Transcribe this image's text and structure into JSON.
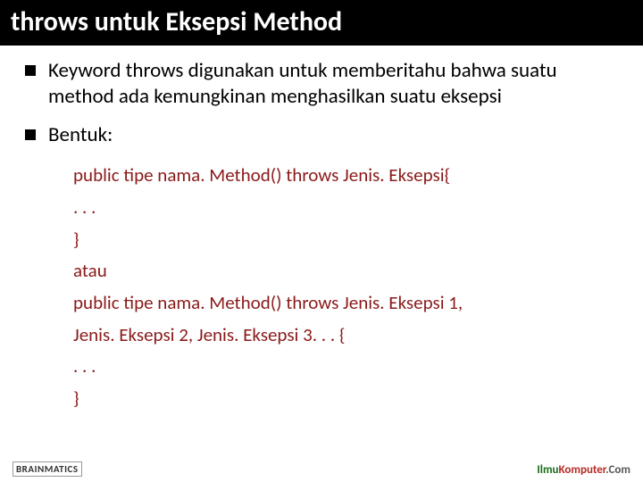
{
  "title": "throws untuk Eksepsi Method",
  "bullets": [
    "Keyword throws digunakan untuk memberitahu bahwa suatu method ada kemungkinan menghasilkan suatu eksepsi",
    "Bentuk:"
  ],
  "code": [
    "public tipe nama. Method() throws Jenis. Eksepsi{",
    ". . .",
    "}",
    "atau",
    "public tipe nama. Method() throws Jenis. Eksepsi 1,",
    "Jenis. Eksepsi 2, Jenis. Eksepsi 3. . . {",
    ". . .",
    "}"
  ],
  "footer": {
    "left_brand": "BRAINMATICS",
    "right_ilmu": "Ilmu",
    "right_komputer": "Komputer",
    "right_com": ".Com"
  }
}
